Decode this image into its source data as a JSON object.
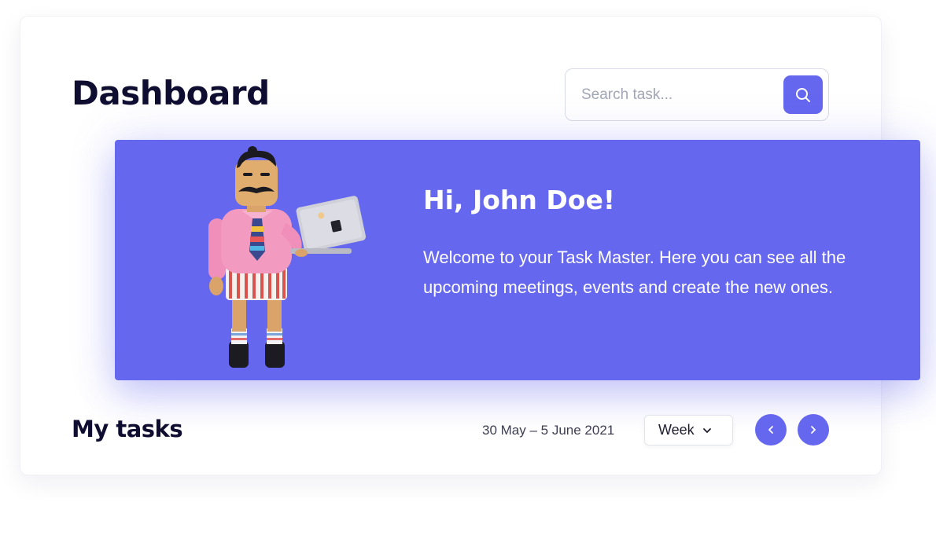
{
  "header": {
    "title": "Dashboard",
    "search": {
      "placeholder": "Search task...",
      "value": "",
      "icon": "search-icon"
    }
  },
  "hero": {
    "greeting": "Hi, John Doe!",
    "message": "Welcome to your Task Master. Here you can see all the upcoming meetings, events and create the new ones.",
    "illustration": "3d-character-holding-laptop"
  },
  "tasks": {
    "title": "My tasks",
    "date_range": "30  May – 5 June 2021",
    "period": {
      "selected": "Week",
      "icon": "chevron-down-icon"
    },
    "prev_icon": "chevron-left-icon",
    "next_icon": "chevron-right-icon"
  },
  "colors": {
    "accent": "#6667ef",
    "heading": "#0f0d30",
    "muted_text": "#3e3e52",
    "placeholder": "#a3a6b4",
    "border": "#d9dce8"
  }
}
